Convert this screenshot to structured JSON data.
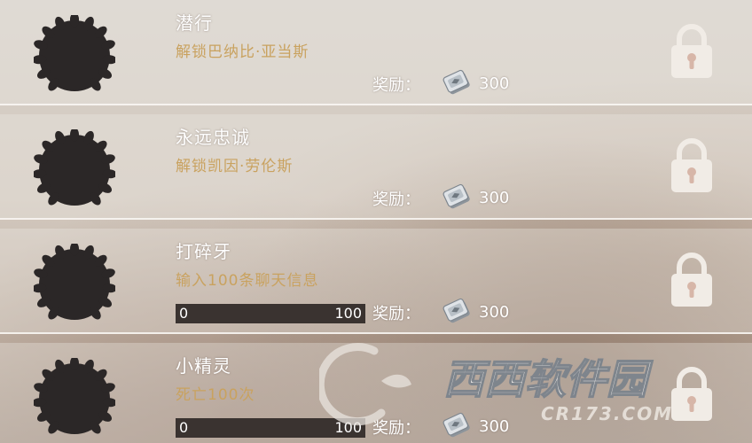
{
  "achievements": [
    {
      "title": "潜行",
      "description": "解锁巴纳比·亚当斯",
      "reward_label": "奖励：",
      "reward_value": "300",
      "reward_icon": "coin-stack-icon",
      "locked": true
    },
    {
      "title": "永远忠诚",
      "description": "解锁凯因·劳伦斯",
      "reward_label": "奖励：",
      "reward_value": "300",
      "reward_icon": "coin-stack-icon",
      "locked": true
    },
    {
      "title": "打碎牙",
      "description": "输入100条聊天信息",
      "reward_label": "奖励：",
      "reward_value": "300",
      "reward_icon": "coin-stack-icon",
      "locked": true,
      "progress": {
        "current": "0",
        "max": "100",
        "fraction": 0
      }
    },
    {
      "title": "小精灵",
      "description": "死亡100次",
      "reward_label": "奖励：",
      "reward_value": "300",
      "reward_icon": "coin-stack-icon",
      "locked": true,
      "progress": {
        "current": "0",
        "max": "100",
        "fraction": 0
      }
    }
  ],
  "watermark": {
    "main": "西西软件园",
    "sub": "CR173.COM"
  },
  "colors": {
    "description": "#c9a25f",
    "badge": "#2b2727",
    "lock": "#f1ece6",
    "lock_keyhole": "#d7b6a8"
  }
}
